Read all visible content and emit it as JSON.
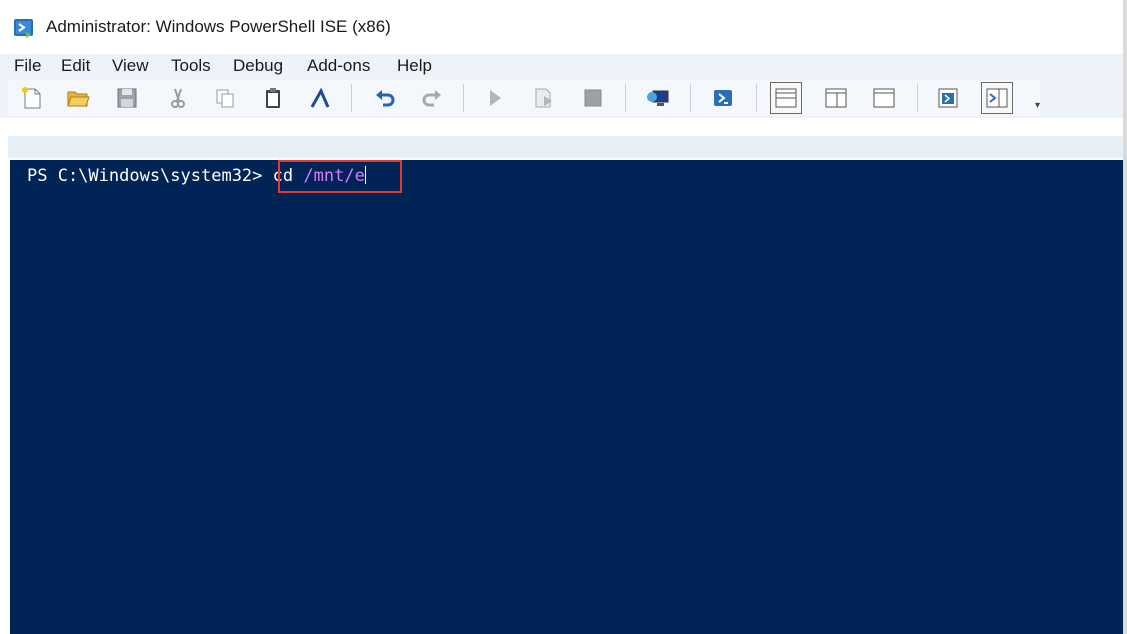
{
  "window": {
    "title": "Administrator: Windows PowerShell ISE (x86)",
    "icon": "powershell-ise-icon"
  },
  "menu": {
    "items": [
      "File",
      "Edit",
      "View",
      "Tools",
      "Debug",
      "Add-ons",
      "Help"
    ]
  },
  "toolbar": {
    "buttons": [
      {
        "name": "new-script",
        "icon": "new-document-icon"
      },
      {
        "name": "open",
        "icon": "open-folder-icon"
      },
      {
        "name": "save",
        "icon": "floppy-disk-icon"
      },
      {
        "name": "cut",
        "icon": "scissors-icon"
      },
      {
        "name": "copy",
        "icon": "copy-icon"
      },
      {
        "name": "paste",
        "icon": "clipboard-icon"
      },
      {
        "name": "clear-console",
        "icon": "broom-icon"
      },
      {
        "name": "undo",
        "icon": "undo-icon"
      },
      {
        "name": "redo",
        "icon": "redo-icon"
      },
      {
        "name": "run-script",
        "icon": "play-icon"
      },
      {
        "name": "run-selection",
        "icon": "run-selection-icon"
      },
      {
        "name": "stop",
        "icon": "stop-icon"
      },
      {
        "name": "new-remote-tab",
        "icon": "remote-computer-icon"
      },
      {
        "name": "start-powershell",
        "icon": "powershell-icon"
      },
      {
        "name": "show-script-pane-top",
        "icon": "layout-top-icon"
      },
      {
        "name": "show-script-pane-right",
        "icon": "layout-right-icon"
      },
      {
        "name": "show-script-pane-maximized",
        "icon": "layout-max-icon"
      },
      {
        "name": "show-script-pane",
        "icon": "script-pane-icon"
      },
      {
        "name": "show-command-addon",
        "icon": "command-addon-icon"
      }
    ],
    "overflow": "▾"
  },
  "console": {
    "prompt": "PS C:\\Windows\\system32>",
    "command": "cd",
    "argument": "/mnt/e",
    "colors": {
      "background": "#012456",
      "text": "#ffffff",
      "argument": "#d67bff",
      "highlight_box": "#e53935"
    }
  }
}
